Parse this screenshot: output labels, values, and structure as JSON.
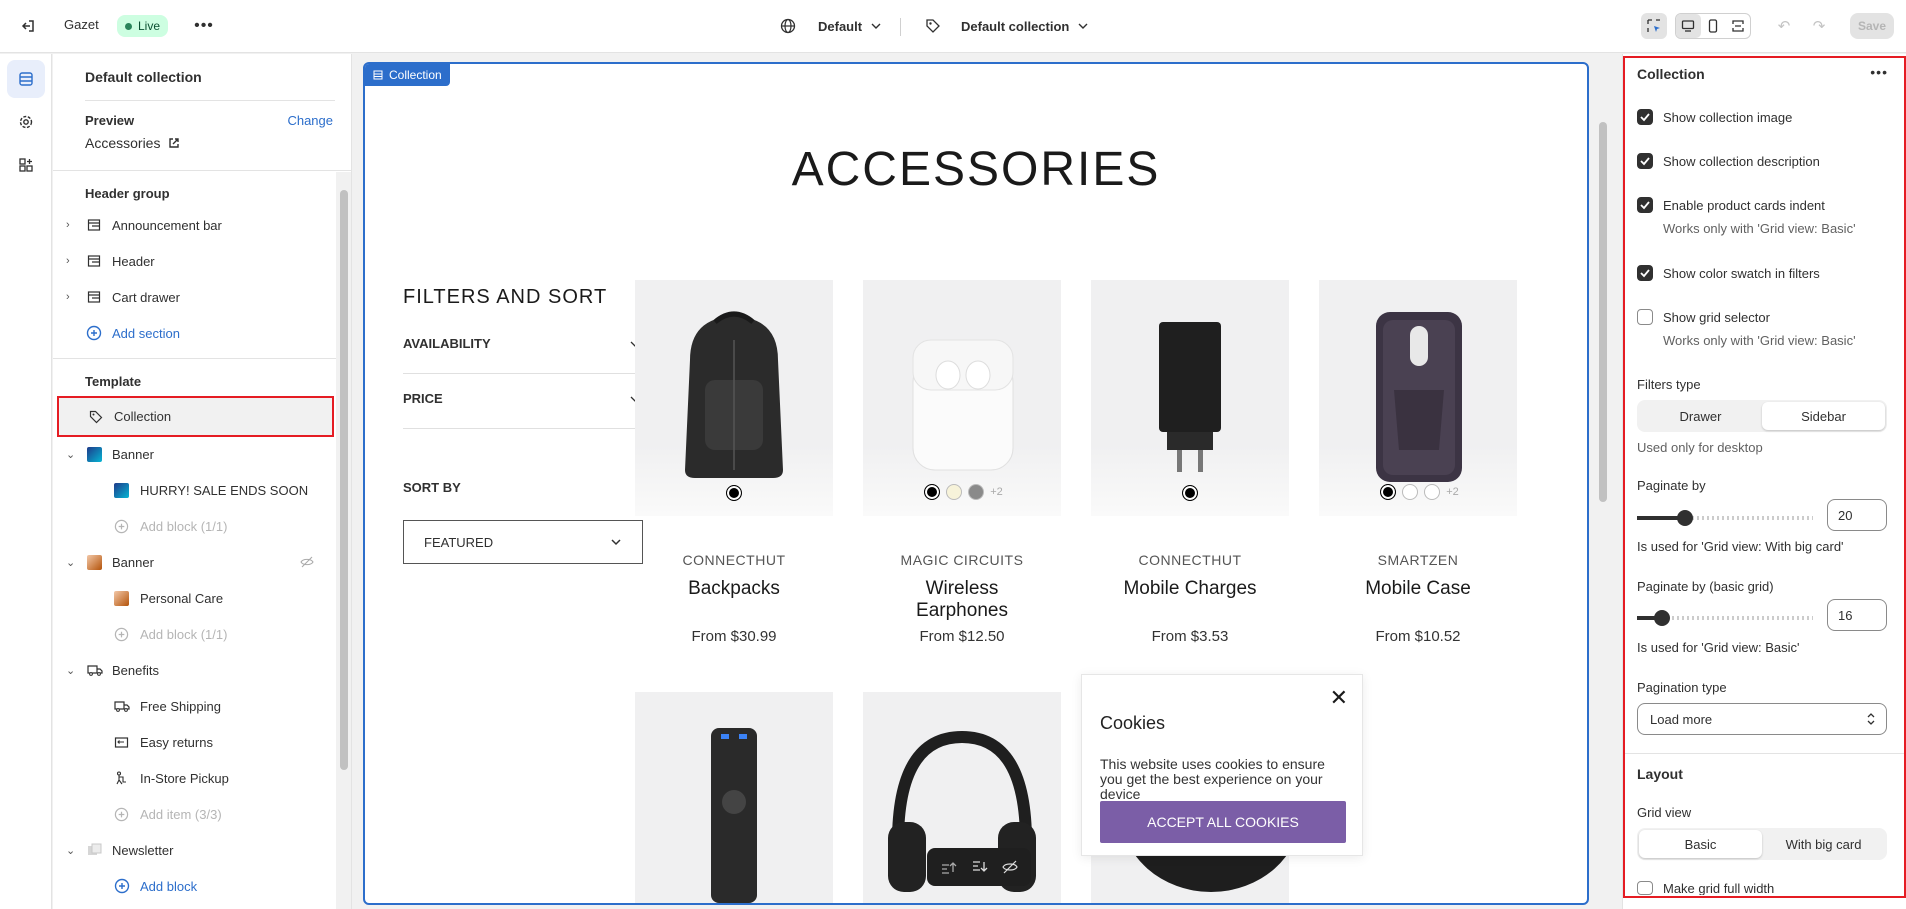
{
  "topbar": {
    "store": "Gazet",
    "status": "Live",
    "theme_selector": "Default",
    "template_selector": "Default collection",
    "save": "Save"
  },
  "left": {
    "title": "Default collection",
    "preview_label": "Preview",
    "preview_change": "Change",
    "preview_value": "Accessories",
    "header_group": "Header group",
    "header_items": [
      "Announcement bar",
      "Header",
      "Cart drawer"
    ],
    "add_section": "Add section",
    "template_label": "Template",
    "collection": "Collection",
    "banner1": "Banner",
    "banner1_child": "HURRY! SALE ENDS SOON",
    "add_block1": "Add block (1/1)",
    "banner2": "Banner",
    "banner2_child": "Personal Care",
    "add_block2": "Add block (1/1)",
    "benefits": "Benefits",
    "benefit_items": [
      "Free Shipping",
      "Easy returns",
      "In-Store Pickup"
    ],
    "add_item": "Add item (3/3)",
    "newsletter": "Newsletter",
    "add_block3": "Add block"
  },
  "preview": {
    "tag": "Collection",
    "heading": "ACCESSORIES",
    "filters_title": "FILTERS AND SORT",
    "filters": [
      "AVAILABILITY",
      "PRICE"
    ],
    "sort_label": "SORT BY",
    "sort_value": "FEATURED",
    "products": [
      {
        "vendor": "CONNECTHUT",
        "name": "Backpacks",
        "price": "From $30.99",
        "more": ""
      },
      {
        "vendor": "MAGIC CIRCUITS",
        "name": "Wireless Earphones",
        "price": "From $12.50",
        "more": "+2"
      },
      {
        "vendor": "CONNECTHUT",
        "name": "Mobile Charges",
        "price": "From $3.53",
        "more": ""
      },
      {
        "vendor": "SMARTZEN",
        "name": "Mobile Case",
        "price": "From $10.52",
        "more": "+2"
      }
    ],
    "cookie": {
      "title": "Cookies",
      "text": "This website uses cookies to ensure you get the best experience on your device",
      "button": "ACCEPT ALL COOKIES"
    }
  },
  "right": {
    "title": "Collection",
    "show_image": "Show collection image",
    "show_desc": "Show collection description",
    "indent": "Enable product cards indent",
    "indent_help": "Works only with 'Grid view: Basic'",
    "swatch": "Show color swatch in filters",
    "grid_selector": "Show grid selector",
    "grid_help": "Works only with 'Grid view: Basic'",
    "filters_type": "Filters type",
    "ft_opts": [
      "Drawer",
      "Sidebar"
    ],
    "ft_help": "Used only for desktop",
    "paginate": "Paginate by",
    "paginate_val": "20",
    "paginate_help": "Is used for 'Grid view: With big card'",
    "paginate_basic": "Paginate by (basic grid)",
    "paginate_basic_val": "16",
    "paginate_basic_help": "Is used for 'Grid view: Basic'",
    "pagination_type": "Pagination type",
    "pagination_value": "Load more",
    "layout": "Layout",
    "grid_view": "Grid view",
    "gv_opts": [
      "Basic",
      "With big card"
    ],
    "full_width": "Make grid full width"
  },
  "colors": {
    "accent": "#2c6ecb",
    "live": "#29845a",
    "cookie_btn": "#7b5ea7",
    "highlight": "#e51c23"
  }
}
